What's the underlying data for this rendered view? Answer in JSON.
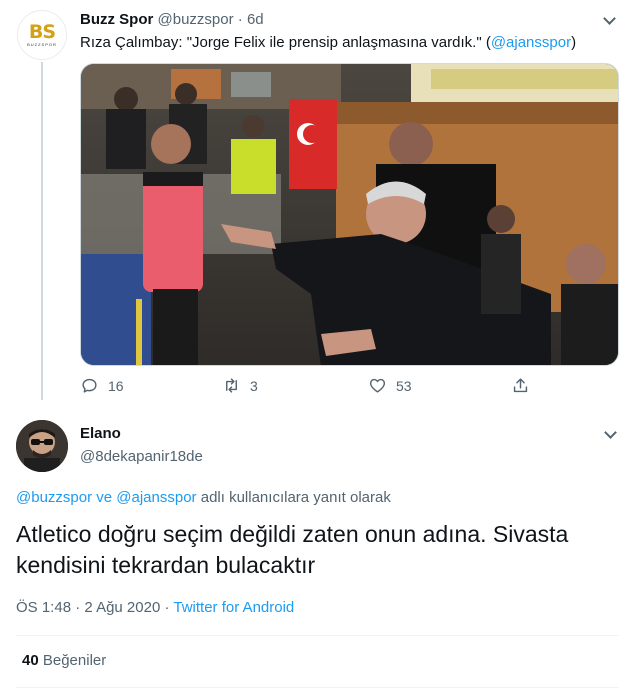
{
  "parent_tweet": {
    "avatar": {
      "mark_b": "B",
      "mark_s": "S",
      "sub": "BUZZSPOR"
    },
    "author_name": "Buzz Spor",
    "author_handle": "@buzzspor",
    "separator": "·",
    "time": "6d",
    "text_prefix": "Rıza Çalımbay: \"Jorge Felix ile prensip anlaşmasına vardık.\" (",
    "text_mention": "@ajansspor",
    "text_suffix": ")",
    "actions": {
      "replies": "16",
      "retweets": "3",
      "likes": "53"
    }
  },
  "reply_tweet": {
    "author_name": "Elano",
    "author_handle": "@8dekapanir18de",
    "replying_to": {
      "mention_1": "@buzzspor",
      "conjunction": " ve ",
      "mention_2": "@ajansspor",
      "suffix": " adlı kullanıcılara yanıt olarak"
    },
    "text": "Atletico doğru seçim değildi zaten onun adına. Sivasta kendisini tekrardan bulacaktır",
    "time": "ÖS 1:48",
    "separator": " · ",
    "date": "2 Ağu 2020",
    "source": "Twitter for Android",
    "likes_count": "40",
    "likes_label": "Beğeniler"
  },
  "icons": {
    "reply": "reply-icon",
    "retweet": "retweet-icon",
    "like": "heart-icon",
    "share": "share-icon",
    "more": "chevron-down-icon"
  },
  "colors": {
    "link": "#1d9bf0",
    "secondary_text": "#536471",
    "primary_text": "#0f1419",
    "thread_line": "#cfd9de"
  }
}
